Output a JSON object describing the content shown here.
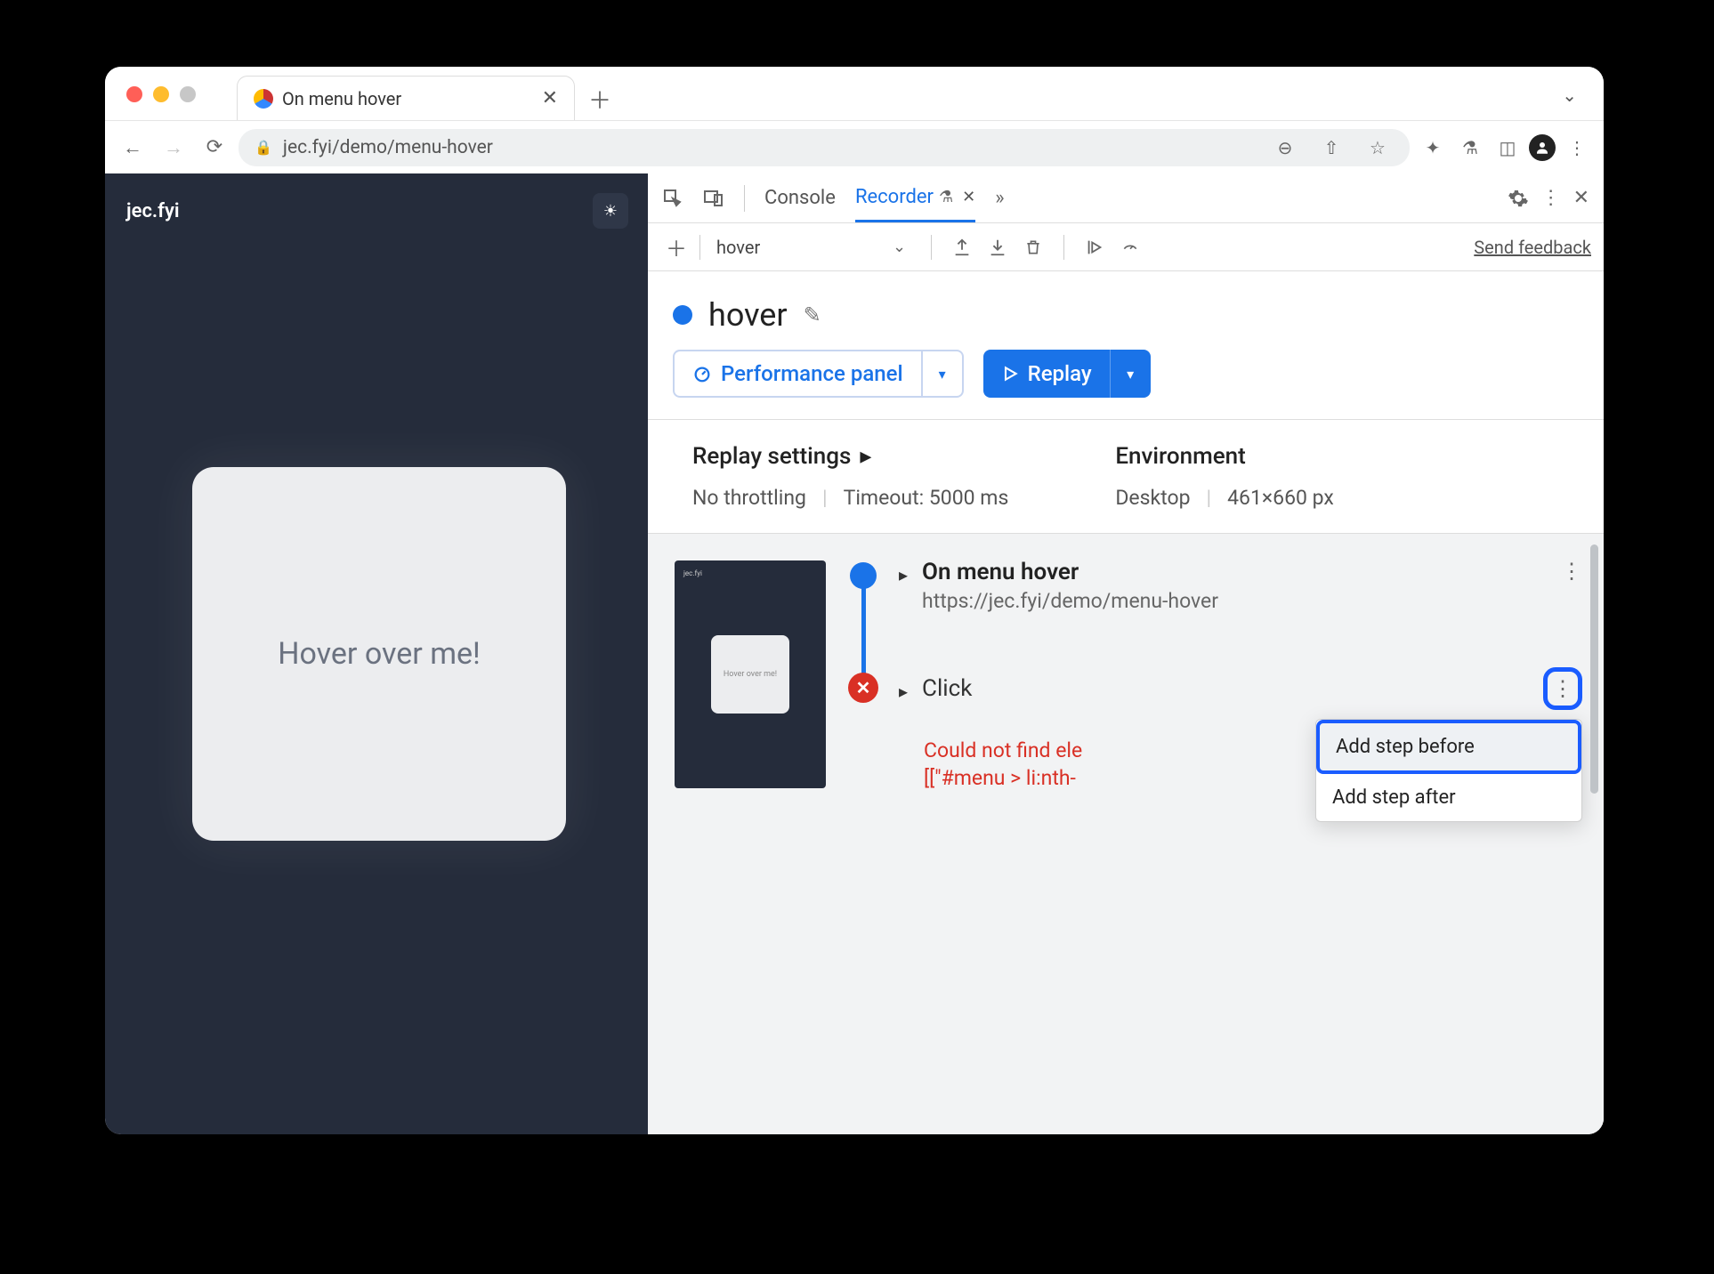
{
  "browser": {
    "tab_title": "On menu hover",
    "url": "jec.fyi/demo/menu-hover"
  },
  "page": {
    "site_title": "jec.fyi",
    "card_text": "Hover over me!"
  },
  "devtools": {
    "tabs": {
      "console": "Console",
      "recorder": "Recorder"
    },
    "recorder_toolbar": {
      "recording_name": "hover",
      "send_feedback": "Send feedback"
    },
    "title": "hover",
    "buttons": {
      "perf_panel": "Performance panel",
      "replay": "Replay"
    },
    "settings": {
      "replay_heading": "Replay settings",
      "throttling": "No throttling",
      "timeout": "Timeout: 5000 ms",
      "env_heading": "Environment",
      "device": "Desktop",
      "dimensions": "461×660 px"
    },
    "steps": {
      "step1_title": "On menu hover",
      "step1_url": "https://jec.fyi/demo/menu-hover",
      "step2_name": "Click",
      "error_line1": "Could not find ele",
      "error_line2": "[[\"#menu > li:nth-",
      "thumb_text": "Hover over me!"
    },
    "context_menu": {
      "before": "Add step before",
      "after": "Add step after"
    }
  }
}
